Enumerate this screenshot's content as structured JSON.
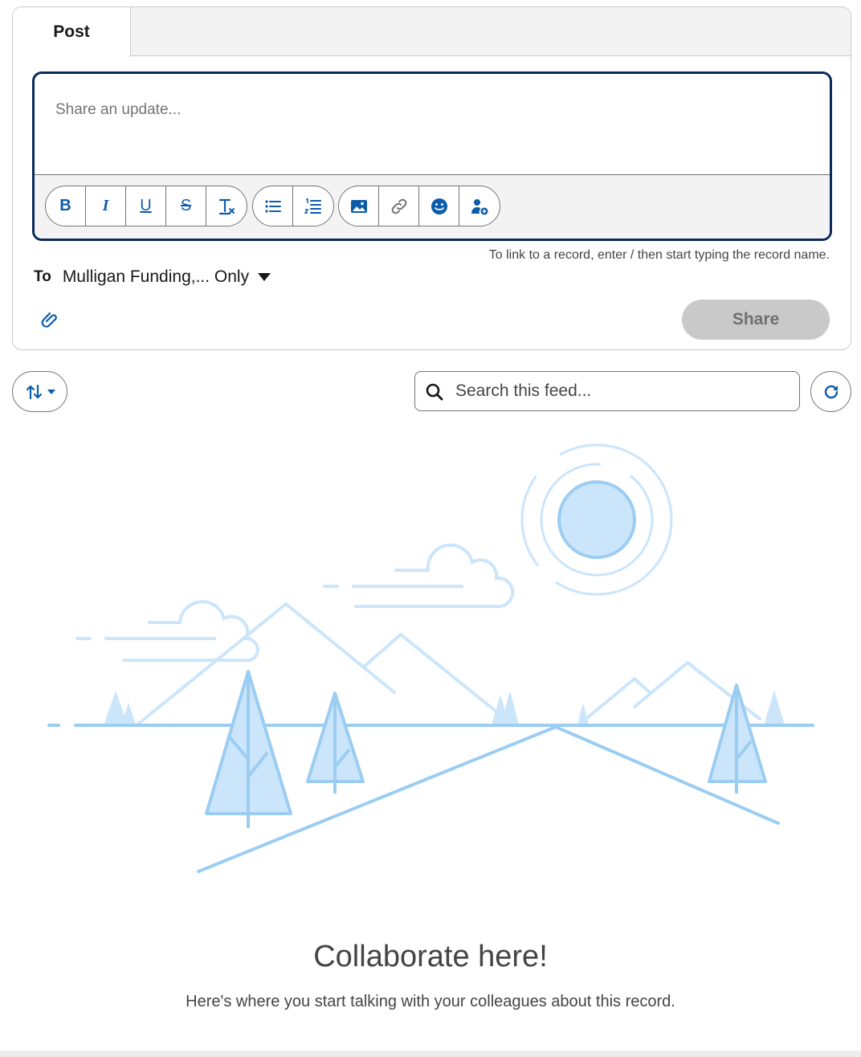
{
  "publisher": {
    "tab_post": "Post",
    "editor_placeholder": "Share an update...",
    "toolbar": {
      "bold_label": "B",
      "italic_label": "I",
      "underline_label": "U",
      "strike_label": "S"
    },
    "hint": "To link to a record, enter / then start typing the record name.",
    "to_label": "To",
    "to_value": "Mulligan Funding,... Only",
    "share_label": "Share"
  },
  "feed": {
    "search_placeholder": "Search this feed..."
  },
  "empty_state": {
    "title": "Collaborate here!",
    "subtitle": "Here's where you start talking with your colleagues about this record."
  },
  "colors": {
    "accent": "#0b5cab",
    "editor_border": "#0b2a5b",
    "illustration_line": "#9bcdf2",
    "illustration_fill": "#cbe5fb",
    "disabled_button": "#c9c9c9"
  },
  "icons": [
    "bold-icon",
    "italic-icon",
    "underline-icon",
    "strikethrough-icon",
    "clear-format-icon",
    "bulleted-list-icon",
    "numbered-list-icon",
    "image-icon",
    "link-icon",
    "emoji-icon",
    "mention-icon",
    "attach-icon",
    "sort-icon",
    "search-icon",
    "refresh-icon"
  ]
}
